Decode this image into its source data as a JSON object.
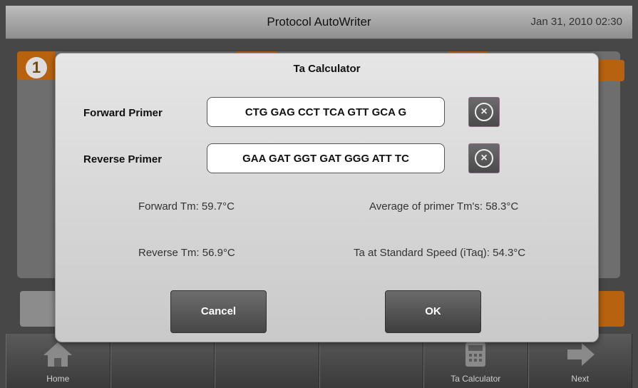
{
  "app": {
    "title": "Protocol AutoWriter",
    "datetime": "Jan 31, 2010 02:30"
  },
  "background": {
    "step_number": "1"
  },
  "dialog": {
    "title": "Ta Calculator",
    "forward": {
      "label": "Forward Primer",
      "value": "CTG GAG CCT TCA GTT GCA G"
    },
    "reverse": {
      "label": "Reverse Primer",
      "value": "GAA GAT GGT GAT GGG ATT TC"
    },
    "forward_tm": "Forward Tm: 59.7°C",
    "reverse_tm": "Reverse Tm: 56.9°C",
    "average_tm": "Average of primer Tm's: 58.3°C",
    "ta_standard": "Ta at Standard Speed (iTaq): 54.3°C",
    "cancel_label": "Cancel",
    "ok_label": "OK"
  },
  "toolbar": {
    "home_label": "Home",
    "ta_calculator_label": "Ta Calculator",
    "next_label": "Next"
  },
  "icons": {
    "home": "home-icon",
    "calculator": "calculator-icon",
    "next": "arrow-right-icon",
    "clear": "clear-circle-x-icon"
  }
}
